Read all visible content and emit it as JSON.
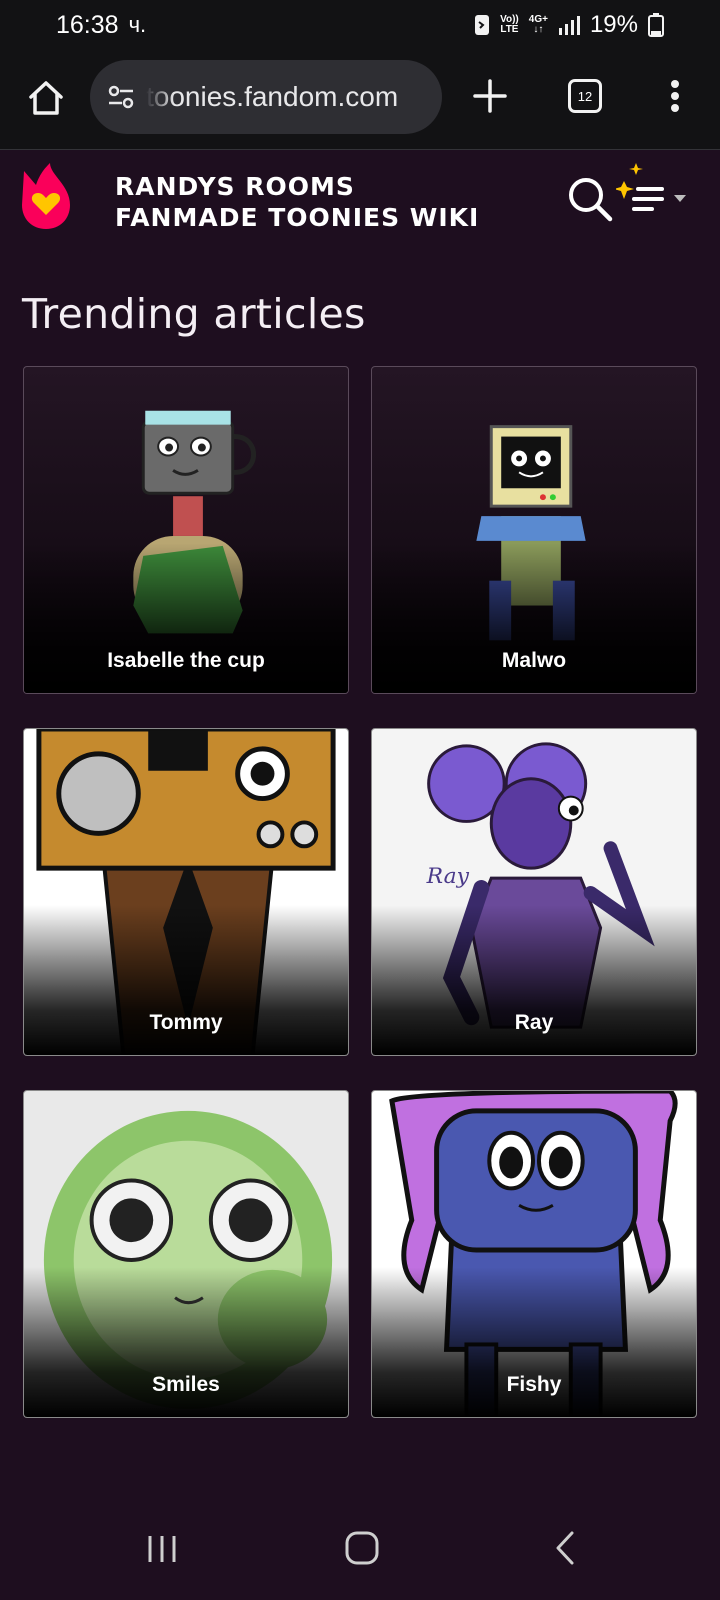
{
  "status": {
    "time": "16:38",
    "carrier_mark": "ч.",
    "network_top": "Vo))",
    "network_bottom": "LTE",
    "data_type": "4G+",
    "battery": "19%"
  },
  "browser": {
    "url": "toonies.fandom.com",
    "tab_count": "12"
  },
  "wiki": {
    "title_line1": "RANDYS ROOMS",
    "title_line2": "FANMADE TOONIES WIKI"
  },
  "trending": {
    "heading": "Trending articles",
    "articles": [
      {
        "label": "Isabelle the cup"
      },
      {
        "label": "Malwo"
      },
      {
        "label": "Tommy"
      },
      {
        "label": "Ray"
      },
      {
        "label": "Smiles"
      },
      {
        "label": "Fishy"
      }
    ]
  },
  "colors": {
    "page_bg": "#1e0e1f",
    "bar_bg": "#121214",
    "fandom_red": "#fa005a",
    "fandom_yellow": "#ffc500",
    "sparkle": "#ffc500"
  },
  "icons": {
    "home": "home-icon",
    "site_info": "tune-icon",
    "new_tab": "plus-icon",
    "menu": "more-vert-icon",
    "search": "search-icon",
    "explore": "sparkle-menu-icon",
    "nav_recents": "recents-icon",
    "nav_home": "nav-home-icon",
    "nav_back": "back-icon"
  }
}
